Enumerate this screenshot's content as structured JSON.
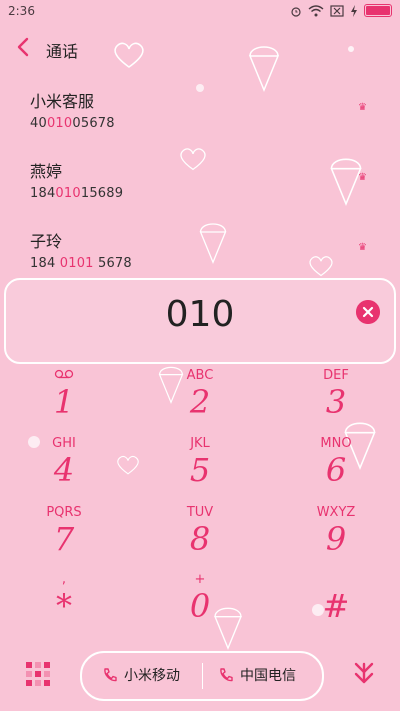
{
  "status_bar": {
    "time": "2:36"
  },
  "header": {
    "title": "通话"
  },
  "contacts": [
    {
      "name": "小米客服",
      "num_pre": "40",
      "num_hl": "010",
      "num_post": "05678"
    },
    {
      "name": "燕婷",
      "num_pre": "184",
      "num_hl": "010",
      "num_post": "15689"
    },
    {
      "name": "子玲",
      "num_pre": "184 ",
      "num_hl": "0101",
      "num_post": " 5678"
    }
  ],
  "dial_input": {
    "value": "010"
  },
  "keypad": [
    {
      "letters": "",
      "digit": "1"
    },
    {
      "letters": "ABC",
      "digit": "2"
    },
    {
      "letters": "DEF",
      "digit": "3"
    },
    {
      "letters": "GHI",
      "digit": "4"
    },
    {
      "letters": "JKL",
      "digit": "5"
    },
    {
      "letters": "MNO",
      "digit": "6"
    },
    {
      "letters": "PQRS",
      "digit": "7"
    },
    {
      "letters": "TUV",
      "digit": "8"
    },
    {
      "letters": "WXYZ",
      "digit": "9"
    },
    {
      "letters": ",",
      "digit": "*"
    },
    {
      "letters": "+",
      "digit": "0"
    },
    {
      "letters": "",
      "digit": "#"
    }
  ],
  "bottom": {
    "sim1": "小米移动",
    "sim2": "中国电信"
  },
  "colors": {
    "background": "#f9c4d6",
    "accent": "#e8336f"
  }
}
